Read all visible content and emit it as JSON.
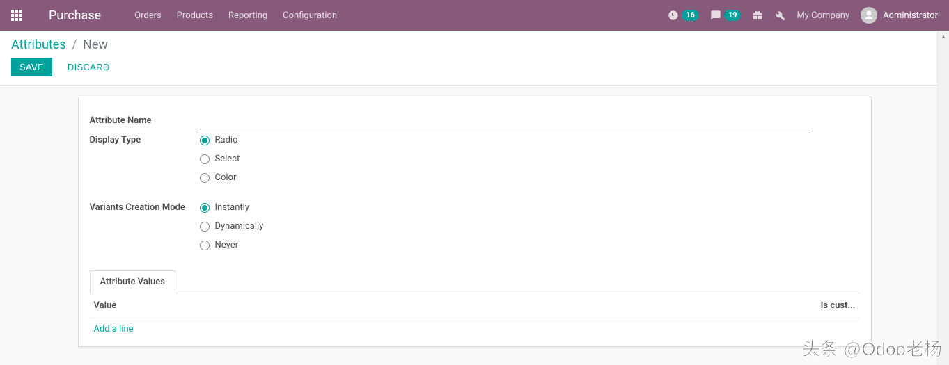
{
  "navbar": {
    "brand": "Purchase",
    "menu": [
      "Orders",
      "Products",
      "Reporting",
      "Configuration"
    ],
    "activities_count": "16",
    "messages_count": "19",
    "company": "My Company",
    "user": "Administrator"
  },
  "breadcrumb": {
    "root": "Attributes",
    "sep": "/",
    "current": "New"
  },
  "buttons": {
    "save": "Save",
    "discard": "Discard"
  },
  "form": {
    "name_label": "Attribute Name",
    "name_value": "",
    "display_type_label": "Display Type",
    "display_type_options": [
      {
        "label": "Radio",
        "checked": true
      },
      {
        "label": "Select",
        "checked": false
      },
      {
        "label": "Color",
        "checked": false
      }
    ],
    "variants_mode_label": "Variants Creation Mode",
    "variants_mode_options": [
      {
        "label": "Instantly",
        "checked": true
      },
      {
        "label": "Dynamically",
        "checked": false
      },
      {
        "label": "Never",
        "checked": false
      }
    ]
  },
  "notebook": {
    "tab": "Attribute Values",
    "columns": {
      "value": "Value",
      "is_custom": "Is cust..."
    },
    "add_line": "Add a line"
  },
  "watermark": "头条 @Odoo老杨"
}
